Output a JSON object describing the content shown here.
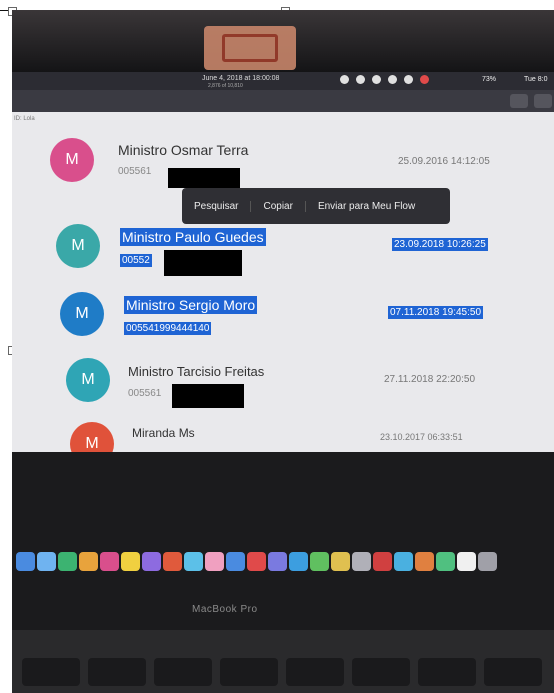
{
  "menubar": {
    "title": "June 4, 2018 at 18:00:08",
    "subtitle": "2,876 of 10,810",
    "battery": "73%",
    "clock": "Tue 8:0",
    "tag": "ID: Lola"
  },
  "context_menu": {
    "items": [
      "Pesquisar",
      "Copiar",
      "Enviar para Meu Flow"
    ]
  },
  "contacts": [
    {
      "initial": "M",
      "name": "Ministro Osmar Terra",
      "phone": "005561",
      "date": "25.09.2016 14:12:05",
      "color": "#d94f8c",
      "selected": false
    },
    {
      "initial": "M",
      "name": "Ministro Paulo Guedes",
      "phone": "00552",
      "date": "23.09.2018 10:26:25",
      "color": "#3aa8a8",
      "selected": true
    },
    {
      "initial": "M",
      "name": "Ministro Sergio Moro",
      "phone": "005541999444140",
      "date": "07.11.2018 19:45:50",
      "color": "#1f7cc7",
      "selected": true
    },
    {
      "initial": "M",
      "name": "Ministro Tarcisio Freitas",
      "phone": "005561",
      "date": "27.11.2018 22:20:50",
      "color": "#2fa5b5",
      "selected": false
    },
    {
      "initial": "M",
      "name": "Miranda Ms",
      "phone": "",
      "date": "23.10.2017 06:33:51",
      "color": "#e0523a",
      "selected": false
    }
  ],
  "laptop": {
    "brand": "MacBook Pro"
  },
  "colors": {
    "highlight": "#1f64d4",
    "menu_bg": "#2f2f34"
  }
}
